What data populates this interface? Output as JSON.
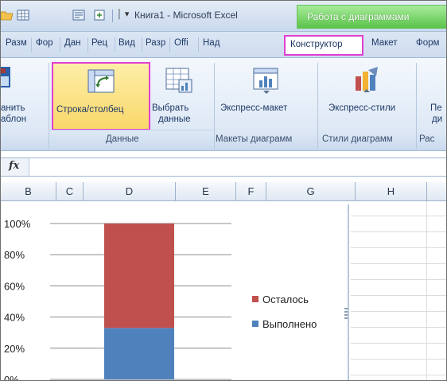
{
  "titlebar": {
    "more_glyph": "│ ▾",
    "app_title": "Книга1  -  Microsoft Excel",
    "context_title": "Работа с диаграммами"
  },
  "tabs": [
    {
      "label": "Разм"
    },
    {
      "label": "Фор"
    },
    {
      "label": "Дан"
    },
    {
      "label": "Рец"
    },
    {
      "label": "Вид"
    },
    {
      "label": "Разр"
    },
    {
      "label": "Offi"
    },
    {
      "label": "Над"
    },
    {
      "label": "Конструктор"
    },
    {
      "label": "Макет"
    },
    {
      "label": "Форм"
    }
  ],
  "ribbon": {
    "save_template": {
      "line1": "анить",
      "line2": "аблон"
    },
    "row_column": {
      "label": "Строка/столбец"
    },
    "select_data": {
      "line1": "Выбрать",
      "line2": "данные"
    },
    "quick_layout": {
      "label": "Экспресс-макет"
    },
    "quick_styles": {
      "label": "Экспресс-стили"
    },
    "move": {
      "line1": "Пе",
      "line2": "ди"
    },
    "groups": {
      "data": "Данные",
      "layouts": "Макеты диаграмм",
      "styles": "Стили диаграмм",
      "location": "Рас"
    }
  },
  "formula_bar": {
    "fx": "fx",
    "value": ""
  },
  "columns": [
    "B",
    "C",
    "D",
    "E",
    "F",
    "G",
    "H"
  ],
  "colors": {
    "accent_highlight": "#e23fd2",
    "series_remaining": "#c0504d",
    "series_done": "#4f81bd"
  },
  "chart_data": {
    "type": "bar",
    "stacked": true,
    "percent": true,
    "categories": [
      ""
    ],
    "series": [
      {
        "name": "Выполнено",
        "values": [
          33
        ]
      },
      {
        "name": "Осталось",
        "values": [
          67
        ]
      }
    ],
    "yticks": [
      "0%",
      "20%",
      "40%",
      "60%",
      "80%",
      "100%"
    ],
    "ylim": [
      0,
      100
    ],
    "grid": true,
    "legend": "right"
  }
}
